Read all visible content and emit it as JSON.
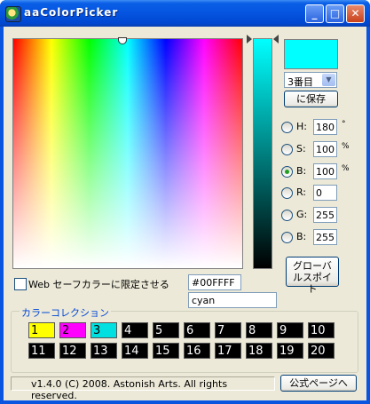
{
  "window": {
    "title": "aaColorPicker"
  },
  "preset": {
    "selected": "3番目",
    "save_label": "に保存"
  },
  "hsb": [
    {
      "label": "H:",
      "value": "180",
      "unit": "°",
      "selected": false
    },
    {
      "label": "S:",
      "value": "100",
      "unit": "%",
      "selected": false
    },
    {
      "label": "B:",
      "value": "100",
      "unit": "%",
      "selected": true
    }
  ],
  "rgb": [
    {
      "label": "R:",
      "value": "0",
      "selected": false
    },
    {
      "label": "G:",
      "value": "255",
      "selected": false
    },
    {
      "label": "B:",
      "value": "255",
      "selected": false
    }
  ],
  "current_color": "#00FFFF",
  "color_name": "cyan",
  "web_safe_label": "Web セーフカラーに限定させる",
  "global_button_label": "グローバルスポイト",
  "collection": {
    "label": "カラーコレクション",
    "slots": [
      {
        "n": "1",
        "color": "#ffff00",
        "text": "#000000"
      },
      {
        "n": "2",
        "color": "#ff00ff",
        "text": "#000000"
      },
      {
        "n": "3",
        "color": "#00e0e0",
        "text": "#000000"
      },
      {
        "n": "4",
        "color": "#000000",
        "text": "#ffffff"
      },
      {
        "n": "5",
        "color": "#000000",
        "text": "#ffffff"
      },
      {
        "n": "6",
        "color": "#000000",
        "text": "#ffffff"
      },
      {
        "n": "7",
        "color": "#000000",
        "text": "#ffffff"
      },
      {
        "n": "8",
        "color": "#000000",
        "text": "#ffffff"
      },
      {
        "n": "9",
        "color": "#000000",
        "text": "#ffffff"
      },
      {
        "n": "10",
        "color": "#000000",
        "text": "#ffffff"
      },
      {
        "n": "11",
        "color": "#000000",
        "text": "#ffffff"
      },
      {
        "n": "12",
        "color": "#000000",
        "text": "#ffffff"
      },
      {
        "n": "13",
        "color": "#000000",
        "text": "#ffffff"
      },
      {
        "n": "14",
        "color": "#000000",
        "text": "#ffffff"
      },
      {
        "n": "15",
        "color": "#000000",
        "text": "#ffffff"
      },
      {
        "n": "16",
        "color": "#000000",
        "text": "#ffffff"
      },
      {
        "n": "17",
        "color": "#000000",
        "text": "#ffffff"
      },
      {
        "n": "18",
        "color": "#000000",
        "text": "#ffffff"
      },
      {
        "n": "19",
        "color": "#000000",
        "text": "#ffffff"
      },
      {
        "n": "20",
        "color": "#000000",
        "text": "#ffffff"
      }
    ]
  },
  "status_text": "v1.4.0  (C) 2008. Astonish Arts. All rights reserved.",
  "homepage_button_label": "公式ページへ"
}
